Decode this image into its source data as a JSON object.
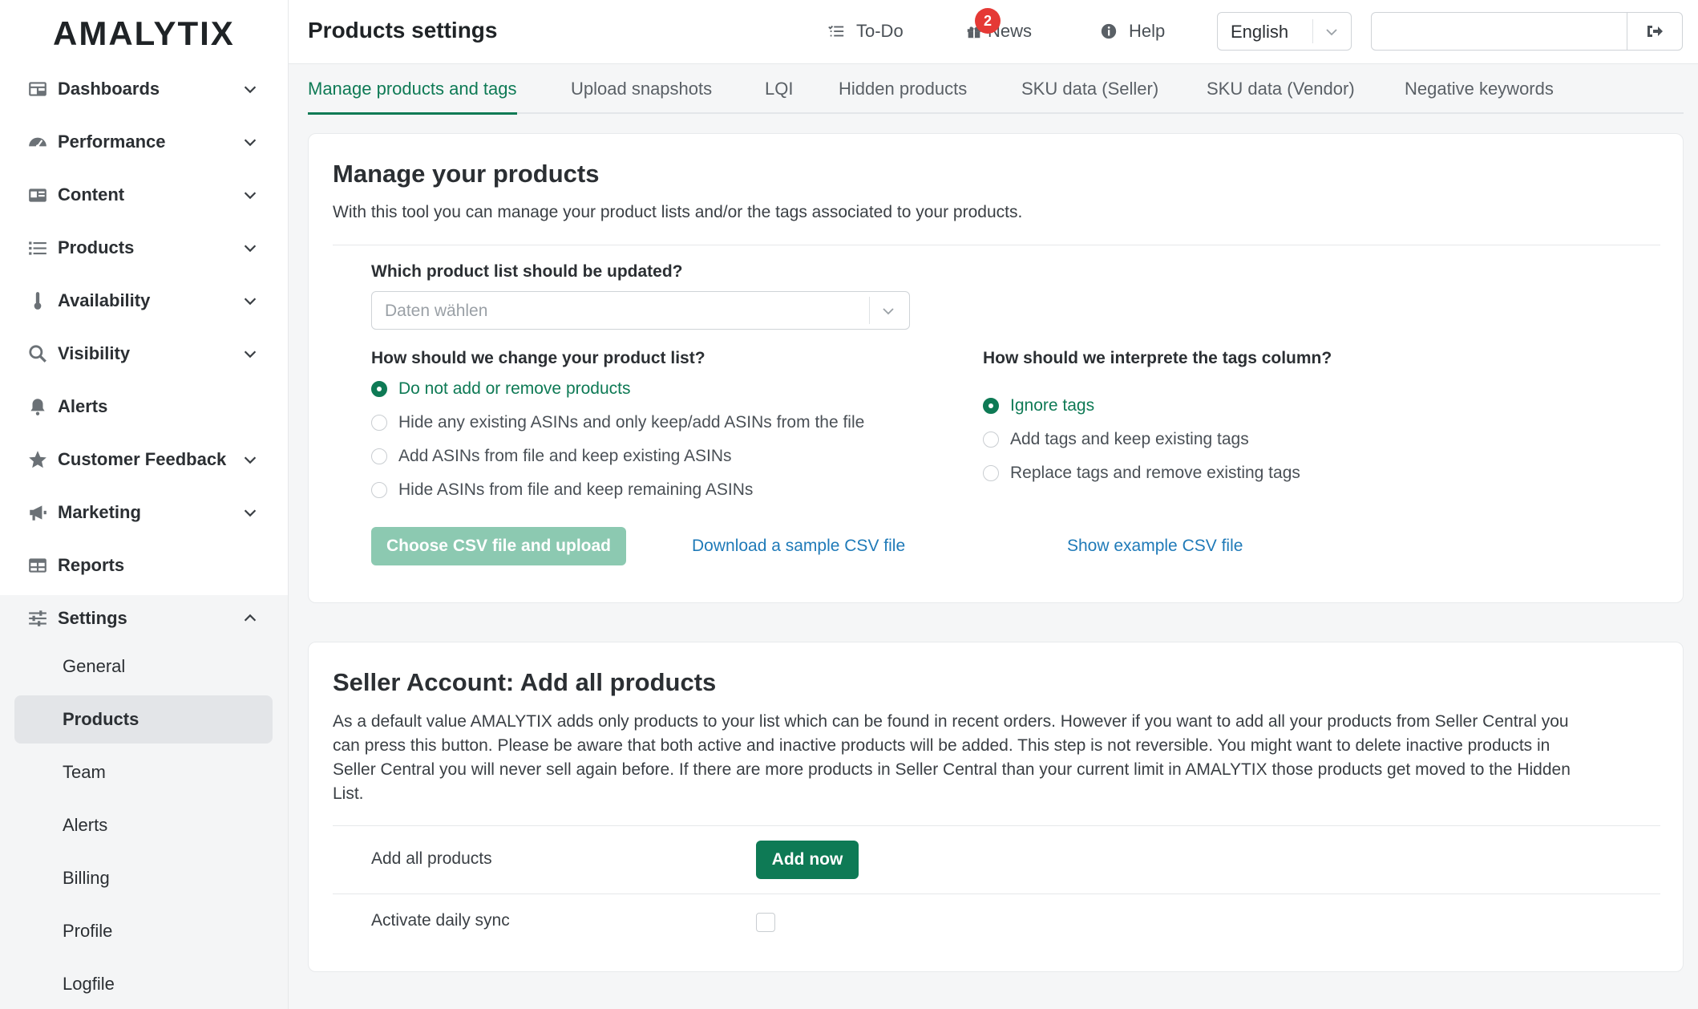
{
  "brand": {
    "logo": "AMALYTIX",
    "accent": "#0e7a55",
    "link": "#1f7ab8"
  },
  "sidebar": {
    "items": [
      {
        "label": "Dashboards",
        "icon": "dashboard-icon",
        "chevron": "down"
      },
      {
        "label": "Performance",
        "icon": "speedometer-icon",
        "chevron": "down"
      },
      {
        "label": "Content",
        "icon": "id-card-icon",
        "chevron": "down"
      },
      {
        "label": "Products",
        "icon": "list-icon",
        "chevron": "down"
      },
      {
        "label": "Availability",
        "icon": "thermometer-icon",
        "chevron": "down"
      },
      {
        "label": "Visibility",
        "icon": "search-icon",
        "chevron": "down"
      },
      {
        "label": "Alerts",
        "icon": "bell-icon",
        "chevron": ""
      },
      {
        "label": "Customer Feedback",
        "icon": "star-icon",
        "chevron": "down"
      },
      {
        "label": "Marketing",
        "icon": "megaphone-icon",
        "chevron": "down"
      },
      {
        "label": "Reports",
        "icon": "table-icon",
        "chevron": ""
      },
      {
        "label": "Settings",
        "icon": "sliders-icon",
        "chevron": "up"
      }
    ],
    "settings_sub": [
      {
        "label": "General"
      },
      {
        "label": "Products",
        "active": true
      },
      {
        "label": "Team"
      },
      {
        "label": "Alerts"
      },
      {
        "label": "Billing"
      },
      {
        "label": "Profile"
      },
      {
        "label": "Logfile"
      }
    ]
  },
  "header": {
    "title": "Products settings",
    "todo": "To-Do",
    "news": "News",
    "news_badge": "2",
    "help": "Help",
    "language": "English",
    "search_value": ""
  },
  "tabs": [
    {
      "label": "Manage products and tags",
      "active": true
    },
    {
      "label": "Upload snapshots"
    },
    {
      "label": "LQI"
    },
    {
      "label": "Hidden products"
    },
    {
      "label": "SKU data (Seller)"
    },
    {
      "label": "SKU data (Vendor)"
    },
    {
      "label": "Negative keywords"
    }
  ],
  "manage": {
    "title": "Manage your products",
    "description": "With this tool you can manage your product lists and/or the tags associated to your products.",
    "list_question": "Which product list should be updated?",
    "list_placeholder": "Daten wählen",
    "change_question": "How should we change your product list?",
    "change_options": [
      {
        "label": "Do not add or remove products",
        "checked": true
      },
      {
        "label": "Hide any existing ASINs and only keep/add ASINs from the file"
      },
      {
        "label": "Add ASINs from file and keep existing ASINs"
      },
      {
        "label": "Hide ASINs from file and keep remaining ASINs"
      }
    ],
    "tags_question": "How should we interprete the tags column?",
    "tags_options": [
      {
        "label": "Ignore tags",
        "checked": true
      },
      {
        "label": "Add tags and keep existing tags"
      },
      {
        "label": "Replace tags and remove existing tags"
      }
    ],
    "upload_button": "Choose CSV file and upload",
    "download_link": "Download a sample CSV file",
    "example_link": "Show example CSV file"
  },
  "seller": {
    "title": "Seller Account: Add all products",
    "description_lines": [
      "As a default value AMALYTIX adds only products to your list which can be found in recent orders. However if you want to add all your products from Seller Central you",
      "can press this button. Please be aware that both active and inactive products will be added. This step is not reversible. You might want to delete inactive products in",
      "Seller Central you will never sell again before. If there are more products in Seller Central than your current limit in AMALYTIX those products get moved to the Hidden",
      "List."
    ],
    "add_all_label": "Add all products",
    "add_now_button": "Add now",
    "daily_sync_label": "Activate daily sync",
    "daily_sync_checked": false
  }
}
